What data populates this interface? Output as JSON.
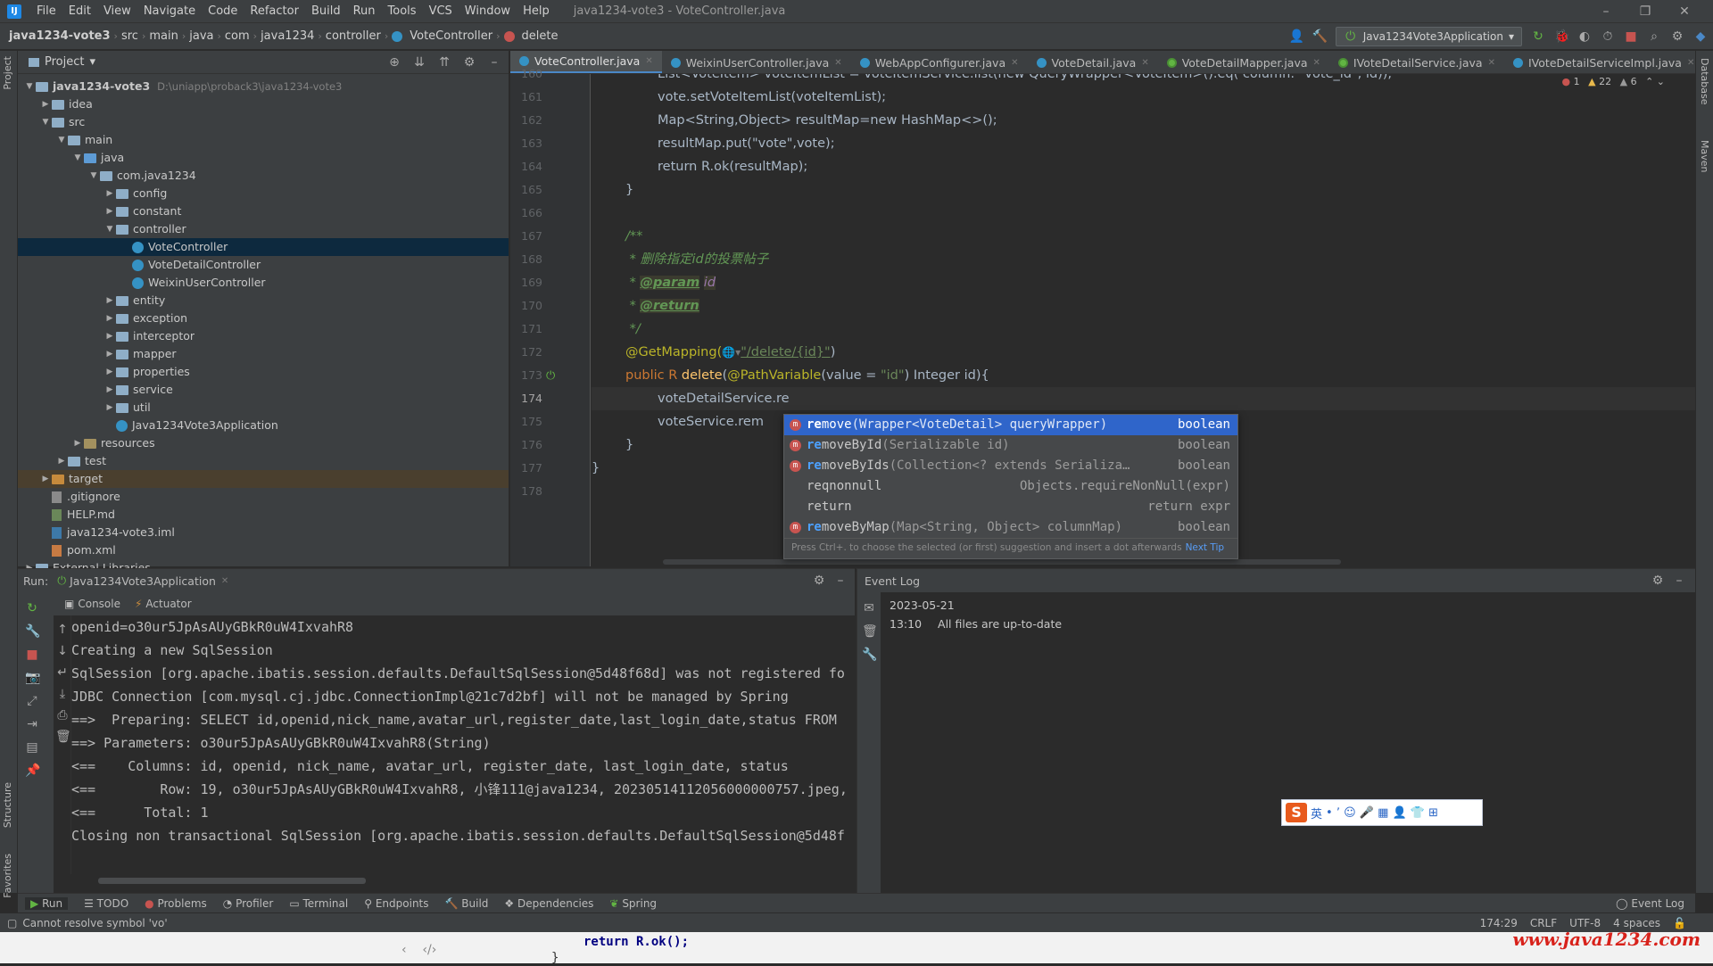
{
  "window": {
    "title": "java1234-vote3 - VoteController.java",
    "menu": [
      "File",
      "Edit",
      "View",
      "Navigate",
      "Code",
      "Refactor",
      "Build",
      "Run",
      "Tools",
      "VCS",
      "Window",
      "Help"
    ],
    "controls": [
      "–",
      "❐",
      "✕"
    ]
  },
  "breadcrumb": [
    "java1234-vote3",
    "src",
    "main",
    "java",
    "com",
    "java1234",
    "controller",
    "VoteController",
    "delete"
  ],
  "run_config": "Java1234Vote3Application",
  "project": {
    "title": "Project",
    "root_name": "java1234-vote3",
    "root_path": "D:\\uniapp\\proback3\\java1234-vote3",
    "nodes": [
      {
        "label": "idea",
        "indent": 1,
        "type": "folder"
      },
      {
        "label": "src",
        "indent": 1,
        "type": "folder",
        "open": true
      },
      {
        "label": "main",
        "indent": 2,
        "type": "folder",
        "open": true
      },
      {
        "label": "java",
        "indent": 3,
        "type": "folder-blue",
        "open": true
      },
      {
        "label": "com.java1234",
        "indent": 4,
        "type": "folder",
        "open": true
      },
      {
        "label": "config",
        "indent": 5,
        "type": "folder"
      },
      {
        "label": "constant",
        "indent": 5,
        "type": "folder"
      },
      {
        "label": "controller",
        "indent": 5,
        "type": "folder",
        "open": true
      },
      {
        "label": "VoteController",
        "indent": 6,
        "type": "class",
        "selected": true
      },
      {
        "label": "VoteDetailController",
        "indent": 6,
        "type": "class"
      },
      {
        "label": "WeixinUserController",
        "indent": 6,
        "type": "class"
      },
      {
        "label": "entity",
        "indent": 5,
        "type": "folder"
      },
      {
        "label": "exception",
        "indent": 5,
        "type": "folder"
      },
      {
        "label": "interceptor",
        "indent": 5,
        "type": "folder"
      },
      {
        "label": "mapper",
        "indent": 5,
        "type": "folder"
      },
      {
        "label": "properties",
        "indent": 5,
        "type": "folder"
      },
      {
        "label": "service",
        "indent": 5,
        "type": "folder"
      },
      {
        "label": "util",
        "indent": 5,
        "type": "folder"
      },
      {
        "label": "Java1234Vote3Application",
        "indent": 5,
        "type": "class-app"
      },
      {
        "label": "resources",
        "indent": 3,
        "type": "folder-res"
      },
      {
        "label": "test",
        "indent": 2,
        "type": "folder"
      },
      {
        "label": "target",
        "indent": 1,
        "type": "folder-orange",
        "excluded": true
      },
      {
        "label": ".gitignore",
        "indent": 1,
        "type": "file"
      },
      {
        "label": "HELP.md",
        "indent": 1,
        "type": "file-md"
      },
      {
        "label": "java1234-vote3.iml",
        "indent": 1,
        "type": "file-iml"
      },
      {
        "label": "pom.xml",
        "indent": 1,
        "type": "file-xml"
      },
      {
        "label": "External Libraries",
        "indent": 0,
        "type": "folder"
      }
    ]
  },
  "tabs": [
    {
      "label": "VoteController.java",
      "active": true,
      "icon": "class"
    },
    {
      "label": "WeixinUserController.java",
      "icon": "class"
    },
    {
      "label": "WebAppConfigurer.java",
      "icon": "class"
    },
    {
      "label": "VoteDetail.java",
      "icon": "class"
    },
    {
      "label": "VoteDetailMapper.java",
      "icon": "interface"
    },
    {
      "label": "IVoteDetailService.java",
      "icon": "interface"
    },
    {
      "label": "IVoteDetailServiceImpl.java",
      "icon": "class"
    },
    {
      "label": "V",
      "icon": "class"
    }
  ],
  "inspections": {
    "errors": "1",
    "warnings": "22",
    "weak": "6"
  },
  "code": {
    "line_numbers": [
      "160",
      "161",
      "162",
      "163",
      "164",
      "165",
      "166",
      "167",
      "168",
      "169",
      "170",
      "171",
      "172",
      "173",
      "174",
      "175",
      "176",
      "177",
      "178"
    ],
    "current_line": "174",
    "line160": "List<VoteItem> voteItemList = voteItemService.list(new QueryWrapper<VoteItem>().eq( column: \"vote_id\", id));",
    "line161": "vote.setVoteItemList(voteItemList);",
    "line162": "Map<String,Object> resultMap=new HashMap<>();",
    "line163": "resultMap.put(\"vote\",vote);",
    "line164": "return R.ok(resultMap);",
    "line165": "}",
    "line167": "/**",
    "line168_prefix": " * ",
    "line168_text": "删除指定id的投票帖子",
    "line169_prefix": " * ",
    "line169_tag": "@param",
    "line169_arg": "id",
    "line170_prefix": " * ",
    "line170_tag": "@return",
    "line171": " */",
    "line172_ann": "@GetMapping(",
    "line172_path": "\"/delete/{id}\"",
    "line172_end": ")",
    "line173_a": "public R ",
    "line173_fn": "delete",
    "line173_b": "(",
    "line173_ann": "@PathVariable",
    "line173_c": "(value = ",
    "line173_str": "\"id\"",
    "line173_d": ") Integer id){",
    "line174": "voteDetailService.re",
    "line175": "voteService.rem",
    "line176": "}",
    "line177": "}"
  },
  "completion": {
    "items": [
      {
        "match": "re",
        "rest": "move",
        "sig": "(Wrapper<VoteDetail> queryWrapper)",
        "ret": "boolean",
        "icon": "m",
        "selected": true
      },
      {
        "match": "re",
        "rest": "moveById",
        "sig": "(Serializable id)",
        "ret": "boolean",
        "icon": "m"
      },
      {
        "match": "re",
        "rest": "moveByIds",
        "sig": "(Collection<? extends Serializa…",
        "ret": "boolean",
        "icon": "m"
      },
      {
        "match": "",
        "rest": "reqnonnull",
        "sig": "",
        "ret": "Objects.requireNonNull(expr)",
        "icon": ""
      },
      {
        "match": "",
        "rest": "return",
        "sig": "",
        "ret": "return expr",
        "icon": ""
      },
      {
        "match": "re",
        "rest": "moveByMap",
        "sig": "(Map<String, Object> columnMap)",
        "ret": "boolean",
        "icon": "m"
      }
    ],
    "tip": "Press Ctrl+. to choose the selected (or first) suggestion and insert a dot afterwards",
    "next_tip": "Next Tip"
  },
  "run": {
    "label": "Run:",
    "config": "Java1234Vote3Application",
    "tabs": [
      "Console",
      "Actuator"
    ],
    "lines": [
      "openid=o30ur5JpAsAUyGBkR0uW4IxvahR8",
      "Creating a new SqlSession",
      "SqlSession [org.apache.ibatis.session.defaults.DefaultSqlSession@5d48f68d] was not registered fo",
      "JDBC Connection [com.mysql.cj.jdbc.ConnectionImpl@21c7d2bf] will not be managed by Spring",
      "==>  Preparing: SELECT id,openid,nick_name,avatar_url,register_date,last_login_date,status FROM",
      "==> Parameters: o30ur5JpAsAUyGBkR0uW4IxvahR8(String)",
      "<==    Columns: id, openid, nick_name, avatar_url, register_date, last_login_date, status",
      "<==        Row: 19, o30ur5JpAsAUyGBkR0uW4IxvahR8, 小锋111@java1234, 20230514112056000000757.jpeg,",
      "<==      Total: 1",
      "Closing non transactional SqlSession [org.apache.ibatis.session.defaults.DefaultSqlSession@5d48f"
    ]
  },
  "eventlog": {
    "title": "Event Log",
    "date": "2023-05-21",
    "time": "13:10",
    "message": "All files are up-to-date"
  },
  "ime": {
    "lang": "英",
    "icons": "• ʼ ☺ 🎤 ▦ 👤 👕 ⊞"
  },
  "bottom_tools": [
    "Run",
    "TODO",
    "Problems",
    "Profiler",
    "Terminal",
    "Endpoints",
    "Build",
    "Dependencies",
    "Spring"
  ],
  "event_log_button": "Event Log",
  "status": {
    "message": "Cannot resolve symbol 'vo'",
    "position": "174:29",
    "line_sep": "CRLF",
    "encoding": "UTF-8",
    "indent": "4 spaces"
  },
  "below": {
    "code_line1": "return R.ok();",
    "code_line2": "}",
    "watermark": "www.java1234.com"
  },
  "side_labels": {
    "left": [
      "Project",
      "Structure",
      "Favorites"
    ],
    "right": [
      "Database",
      "Maven"
    ]
  }
}
